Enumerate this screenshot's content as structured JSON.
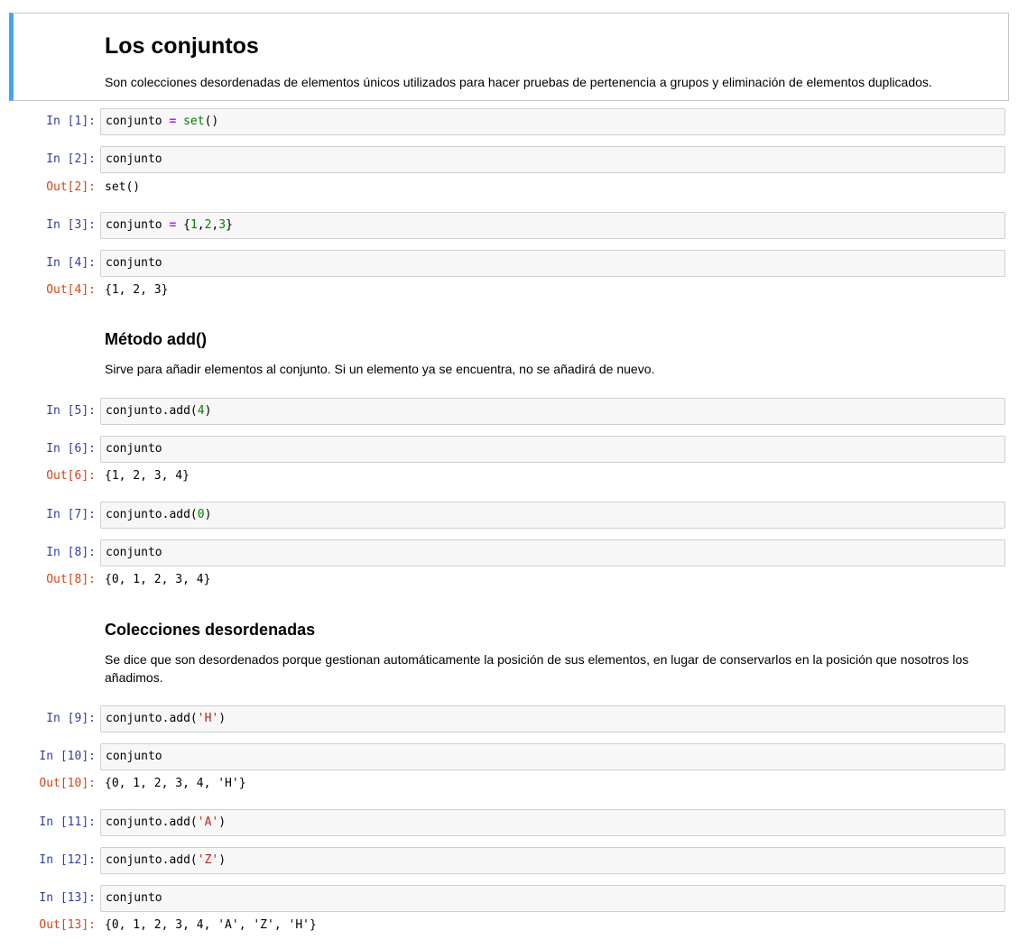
{
  "cells": [
    {
      "kind": "md",
      "h1": "Los conjuntos",
      "p": "Son colecciones desordenadas de elementos únicos utilizados para hacer pruebas de pertenencia a grupos y eliminación de elementos duplicados."
    },
    {
      "kind": "code",
      "prompt": "In [1]:",
      "tokens": [
        {
          "t": "conjunto "
        },
        {
          "t": "=",
          "c": "op"
        },
        {
          "t": " "
        },
        {
          "t": "set",
          "c": "bi"
        },
        {
          "t": "()"
        }
      ]
    },
    {
      "kind": "code",
      "prompt": "In [2]:",
      "tokens": [
        {
          "t": "conjunto"
        }
      ]
    },
    {
      "kind": "out",
      "prompt": "Out[2]:",
      "text": "set()"
    },
    {
      "kind": "code",
      "prompt": "In [3]:",
      "tokens": [
        {
          "t": "conjunto "
        },
        {
          "t": "=",
          "c": "op"
        },
        {
          "t": " {"
        },
        {
          "t": "1",
          "c": "num"
        },
        {
          "t": ","
        },
        {
          "t": "2",
          "c": "num"
        },
        {
          "t": ","
        },
        {
          "t": "3",
          "c": "num"
        },
        {
          "t": "}"
        }
      ]
    },
    {
      "kind": "code",
      "prompt": "In [4]:",
      "tokens": [
        {
          "t": "conjunto"
        }
      ]
    },
    {
      "kind": "out",
      "prompt": "Out[4]:",
      "text": "{1, 2, 3}"
    },
    {
      "kind": "md",
      "h2": "Método add()",
      "p": "Sirve para añadir elementos al conjunto. Si un elemento ya se encuentra, no se añadirá de nuevo."
    },
    {
      "kind": "code",
      "prompt": "In [5]:",
      "tokens": [
        {
          "t": "conjunto.add("
        },
        {
          "t": "4",
          "c": "num"
        },
        {
          "t": ")"
        }
      ]
    },
    {
      "kind": "code",
      "prompt": "In [6]:",
      "tokens": [
        {
          "t": "conjunto"
        }
      ]
    },
    {
      "kind": "out",
      "prompt": "Out[6]:",
      "text": "{1, 2, 3, 4}"
    },
    {
      "kind": "code",
      "prompt": "In [7]:",
      "tokens": [
        {
          "t": "conjunto.add("
        },
        {
          "t": "0",
          "c": "num"
        },
        {
          "t": ")"
        }
      ]
    },
    {
      "kind": "code",
      "prompt": "In [8]:",
      "tokens": [
        {
          "t": "conjunto"
        }
      ]
    },
    {
      "kind": "out",
      "prompt": "Out[8]:",
      "text": "{0, 1, 2, 3, 4}"
    },
    {
      "kind": "md",
      "h2": "Colecciones desordenadas",
      "p": "Se dice que son desordenados porque gestionan automáticamente la posición de sus elementos, en lugar de conservarlos en la posición que nosotros los añadimos."
    },
    {
      "kind": "code",
      "prompt": "In [9]:",
      "tokens": [
        {
          "t": "conjunto.add("
        },
        {
          "t": "'H'",
          "c": "str"
        },
        {
          "t": ")"
        }
      ]
    },
    {
      "kind": "code",
      "prompt": "In [10]:",
      "tokens": [
        {
          "t": "conjunto"
        }
      ]
    },
    {
      "kind": "out",
      "prompt": "Out[10]:",
      "text": "{0, 1, 2, 3, 4, 'H'}"
    },
    {
      "kind": "code",
      "prompt": "In [11]:",
      "tokens": [
        {
          "t": "conjunto.add("
        },
        {
          "t": "'A'",
          "c": "str"
        },
        {
          "t": ")"
        }
      ]
    },
    {
      "kind": "code",
      "prompt": "In [12]:",
      "tokens": [
        {
          "t": "conjunto.add("
        },
        {
          "t": "'Z'",
          "c": "str"
        },
        {
          "t": ")"
        }
      ]
    },
    {
      "kind": "code",
      "prompt": "In [13]:",
      "tokens": [
        {
          "t": "conjunto"
        }
      ]
    },
    {
      "kind": "out",
      "prompt": "Out[13]:",
      "text": "{0, 1, 2, 3, 4, 'A', 'Z', 'H'}"
    }
  ],
  "colors": {
    "prompt_in": "#303f9f",
    "prompt_out": "#d84315",
    "markdown_accent": "#42a5f5",
    "token_operator": "#aa22ff",
    "token_number": "#008000",
    "token_builtin": "#008000",
    "token_string": "#ba2121"
  }
}
